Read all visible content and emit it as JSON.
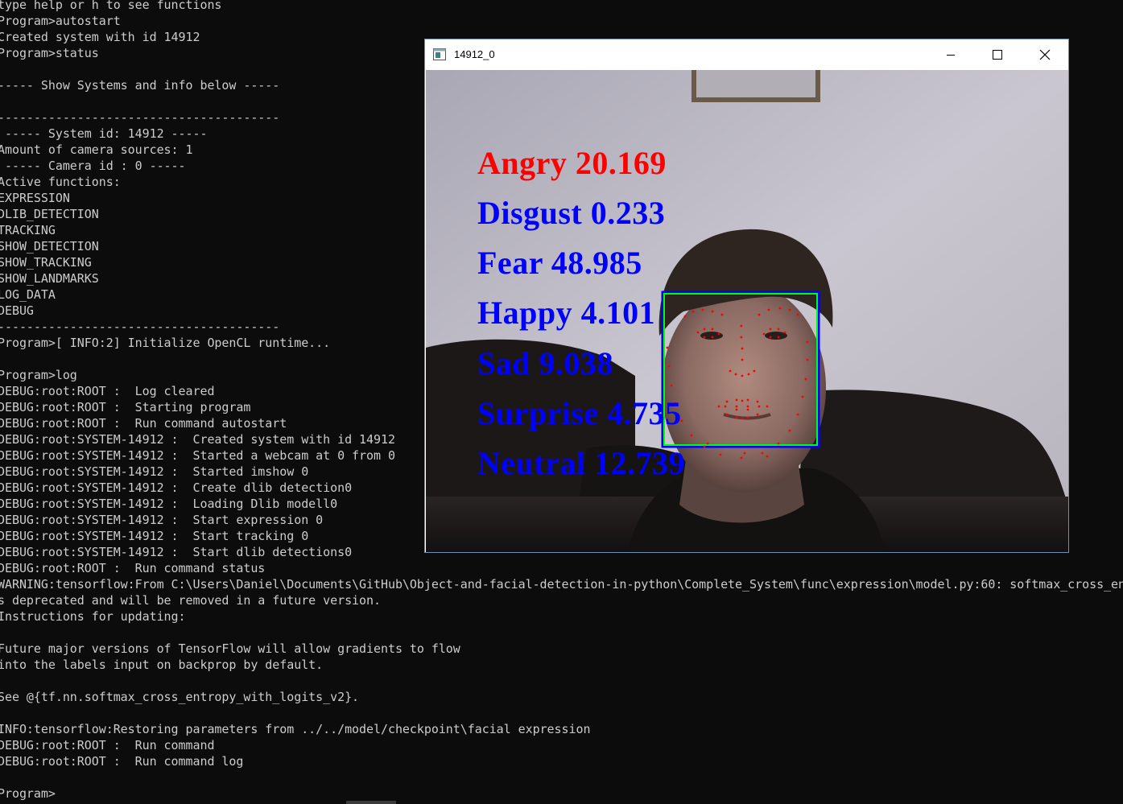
{
  "console": {
    "lines": [
      "type help or h to see functions",
      "Program>autostart",
      "Created system with id 14912",
      "Program>status",
      "",
      "----- Show Systems and info below -----",
      "",
      "---------------------------------------",
      " ----- System id: 14912 -----",
      "Amount of camera sources: 1",
      " ----- Camera id : 0 -----",
      "Active functions:",
      "EXPRESSION",
      "DLIB_DETECTION",
      "TRACKING",
      "SHOW_DETECTION",
      "SHOW_TRACKING",
      "SHOW_LANDMARKS",
      "LOG_DATA",
      "DEBUG",
      "---------------------------------------",
      "Program>[ INFO:2] Initialize OpenCL runtime...",
      "",
      "Program>log",
      "DEBUG:root:ROOT :  Log cleared",
      "DEBUG:root:ROOT :  Starting program",
      "DEBUG:root:ROOT :  Run command autostart",
      "DEBUG:root:SYSTEM-14912 :  Created system with id 14912",
      "DEBUG:root:SYSTEM-14912 :  Started a webcam at 0 from 0",
      "DEBUG:root:SYSTEM-14912 :  Started imshow 0",
      "DEBUG:root:SYSTEM-14912 :  Create dlib detection0",
      "DEBUG:root:SYSTEM-14912 :  Loading Dlib modell0",
      "DEBUG:root:SYSTEM-14912 :  Start expression 0",
      "DEBUG:root:SYSTEM-14912 :  Start tracking 0",
      "DEBUG:root:SYSTEM-14912 :  Start dlib detections0",
      "DEBUG:root:ROOT :  Run command status",
      "WARNING:tensorflow:From C:\\Users\\Daniel\\Documents\\GitHub\\Object-and-facial-detection-in-python\\Complete_System\\func\\expression\\model.py:60: softmax_cross_en",
      "s deprecated and will be removed in a future version.",
      "Instructions for updating:",
      "",
      "Future major versions of TensorFlow will allow gradients to flow",
      "into the labels input on backprop by default.",
      "",
      "See @{tf.nn.softmax_cross_entropy_with_logits_v2}.",
      "",
      "INFO:tensorflow:Restoring parameters from ../../model/checkpoint\\facial expression",
      "DEBUG:root:ROOT :  Run command",
      "DEBUG:root:ROOT :  Run command log",
      "",
      "Program>"
    ]
  },
  "window": {
    "title": "14912_0",
    "buttons": {
      "minimize": "minimize",
      "maximize": "maximize",
      "close": "close"
    }
  },
  "overlay": {
    "emotions": [
      {
        "label": "Angry 20.169",
        "color": "#ff0000"
      },
      {
        "label": "Disgust 0.233",
        "color": "#0000ff"
      },
      {
        "label": "Fear 48.985",
        "color": "#0000ff"
      },
      {
        "label": "Happy 4.101",
        "color": "#0000ff"
      },
      {
        "label": "Sad 9.038",
        "color": "#0000ff"
      },
      {
        "label": "Surprise 4.735",
        "color": "#0000ff"
      },
      {
        "label": "Neutral 12.739",
        "color": "#0000ff"
      }
    ],
    "detection_box_colors": {
      "outer": "#0000ff",
      "inner": "#00ff00"
    },
    "landmark_color": "#ff0000"
  },
  "colors": {
    "console_bg": "#0c0c0c",
    "console_text": "#cccccc"
  }
}
